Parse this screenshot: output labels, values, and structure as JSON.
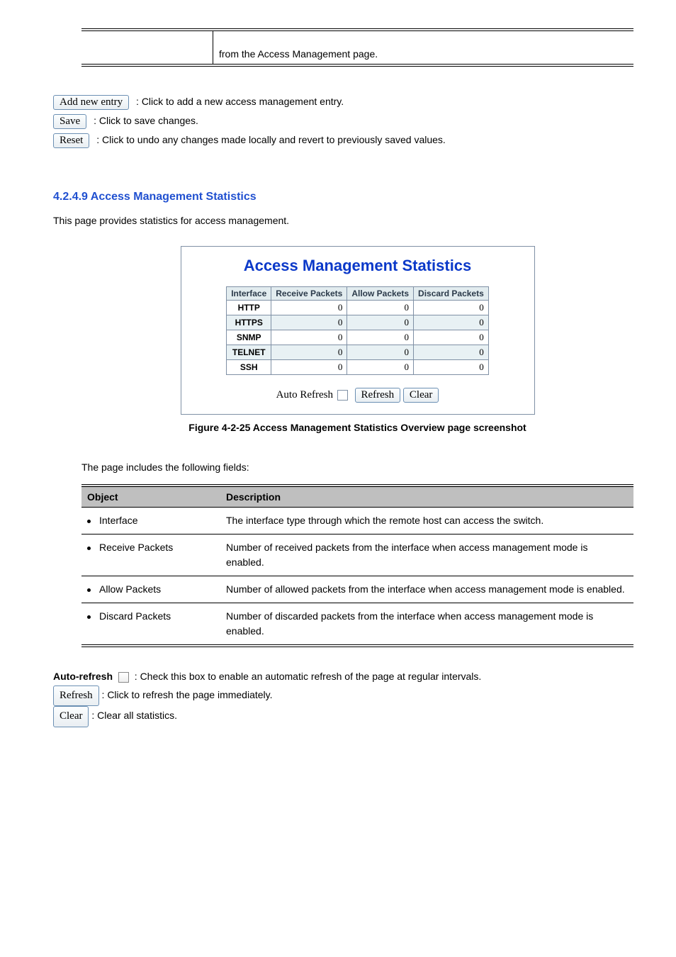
{
  "top_table_left": "",
  "top_table_right_line": "from the Access Management page.",
  "buttons": {
    "add": "Add new entry",
    "add_desc_pre": ": Click to add a new access management entry",
    "add_desc_post": ".",
    "save": "Save",
    "save_desc": ": Click to save changes.",
    "reset": "Reset",
    "reset_desc": ": Click to undo any changes made locally and revert to previously saved values."
  },
  "sec_heading": "4.2.4.9 Access Management Statistics",
  "sec_desc": "This page provides statistics for access management.",
  "shot": {
    "title": "Access Management Statistics",
    "cols": [
      "Interface",
      "Receive Packets",
      "Allow Packets",
      "Discard Packets"
    ],
    "rows": [
      [
        "HTTP",
        "0",
        "0",
        "0"
      ],
      [
        "HTTPS",
        "0",
        "0",
        "0"
      ],
      [
        "SNMP",
        "0",
        "0",
        "0"
      ],
      [
        "TELNET",
        "0",
        "0",
        "0"
      ],
      [
        "SSH",
        "0",
        "0",
        "0"
      ]
    ],
    "auto": "Auto Refresh",
    "refresh": "Refresh",
    "clear": "Clear"
  },
  "figcap": "Figure 4-2-25 Access Management Statistics Overview page screenshot",
  "desc_intro": "The page includes the following fields:",
  "desc_table": {
    "head": [
      "Object",
      "Description"
    ],
    "rows": [
      [
        "Interface",
        "The interface type through which the remote host can access the switch."
      ],
      [
        "Receive Packets",
        "Number of received packets from the interface when access management mode is enabled."
      ],
      [
        "Allow Packets",
        "Number of allowed packets from the interface when access management mode is enabled."
      ],
      [
        "Discard Packets",
        "Number of discarded packets from the interface when access management mode is enabled."
      ]
    ]
  },
  "notes": {
    "autorefresh_pre": "Auto-refresh",
    "autorefresh_post": ": Check this box to enable an automatic refresh of the page at regular intervals.",
    "refresh_btn": "Refresh",
    "refresh_desc": ": Click to refresh the page immediately.",
    "clear_btn": "Clear",
    "clear_desc": ": Clear all statistics."
  }
}
